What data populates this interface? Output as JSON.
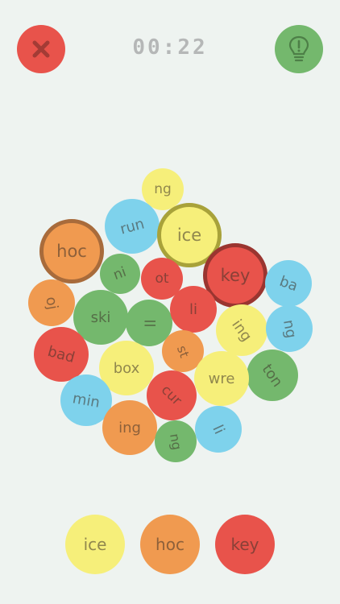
{
  "header": {
    "timer": "00:22",
    "close_icon": "close-x-icon",
    "hint_icon": "lightbulb-exclamation-icon"
  },
  "colors": {
    "red": "#e8534b",
    "orange": "#f09a50",
    "yellow": "#f6ef7a",
    "green": "#74b86d",
    "blue": "#7ed2ec",
    "background": "#eef3f0"
  },
  "board": {
    "bubbles": [
      {
        "label": "ng",
        "color": "yellow"
      },
      {
        "label": "run",
        "color": "blue"
      },
      {
        "label": "ice",
        "color": "yellow",
        "selected": true
      },
      {
        "label": "hoc",
        "color": "orange",
        "selected": true
      },
      {
        "label": "key",
        "color": "red",
        "selected": true
      },
      {
        "label": "ni",
        "color": "green"
      },
      {
        "label": "ot",
        "color": "red"
      },
      {
        "label": "ba",
        "color": "blue"
      },
      {
        "label": "oj",
        "color": "orange"
      },
      {
        "label": "ski",
        "color": "green"
      },
      {
        "label": "ll",
        "color": "green"
      },
      {
        "label": "li",
        "color": "red"
      },
      {
        "label": "ing",
        "color": "yellow"
      },
      {
        "label": "ng",
        "color": "blue"
      },
      {
        "label": "bad",
        "color": "red"
      },
      {
        "label": "box",
        "color": "yellow"
      },
      {
        "label": "st",
        "color": "orange"
      },
      {
        "label": "ton",
        "color": "green"
      },
      {
        "label": "wre",
        "color": "yellow"
      },
      {
        "label": "cur",
        "color": "red"
      },
      {
        "label": "min",
        "color": "blue"
      },
      {
        "label": "ing",
        "color": "orange"
      },
      {
        "label": "ng",
        "color": "green"
      },
      {
        "label": "li",
        "color": "blue"
      }
    ]
  },
  "answer": {
    "slots": [
      {
        "label": "ice",
        "color": "yellow"
      },
      {
        "label": "hoc",
        "color": "orange"
      },
      {
        "label": "key",
        "color": "red"
      }
    ]
  }
}
